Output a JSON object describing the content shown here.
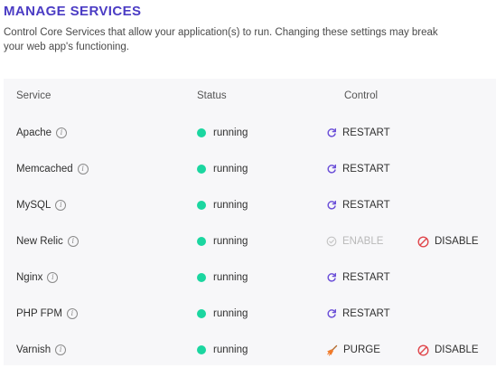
{
  "page": {
    "title": "MANAGE SERVICES",
    "description": "Control Core Services that allow your application(s) to run. Changing these settings may break your web app's functioning."
  },
  "table": {
    "headers": {
      "service": "Service",
      "status": "Status",
      "control": "Control"
    },
    "rows": [
      {
        "service": "Apache",
        "status": "running",
        "action1": "RESTART",
        "action1_icon": "restart-icon",
        "action1_enabled": true,
        "action2": ""
      },
      {
        "service": "Memcached",
        "status": "running",
        "action1": "RESTART",
        "action1_icon": "restart-icon",
        "action1_enabled": true,
        "action2": ""
      },
      {
        "service": "MySQL",
        "status": "running",
        "action1": "RESTART",
        "action1_icon": "restart-icon",
        "action1_enabled": true,
        "action2": ""
      },
      {
        "service": "New Relic",
        "status": "running",
        "action1": "ENABLE",
        "action1_icon": "check-circle-icon",
        "action1_enabled": false,
        "action2": "DISABLE",
        "action2_icon": "disable-icon"
      },
      {
        "service": "Nginx",
        "status": "running",
        "action1": "RESTART",
        "action1_icon": "restart-icon",
        "action1_enabled": true,
        "action2": ""
      },
      {
        "service": "PHP FPM",
        "status": "running",
        "action1": "RESTART",
        "action1_icon": "restart-icon",
        "action1_enabled": true,
        "action2": ""
      },
      {
        "service": "Varnish",
        "status": "running",
        "action1": "PURGE",
        "action1_icon": "broom-icon",
        "action1_enabled": true,
        "action2": "DISABLE",
        "action2_icon": "disable-icon"
      }
    ]
  },
  "colors": {
    "title": "#4b3cc4",
    "running_dot": "#1bd6a0",
    "restart_icon": "#6b4fd8",
    "disable_icon": "#e0474c",
    "purge_icon": "#f07a2a",
    "disabled_text": "#b9b9b9"
  }
}
